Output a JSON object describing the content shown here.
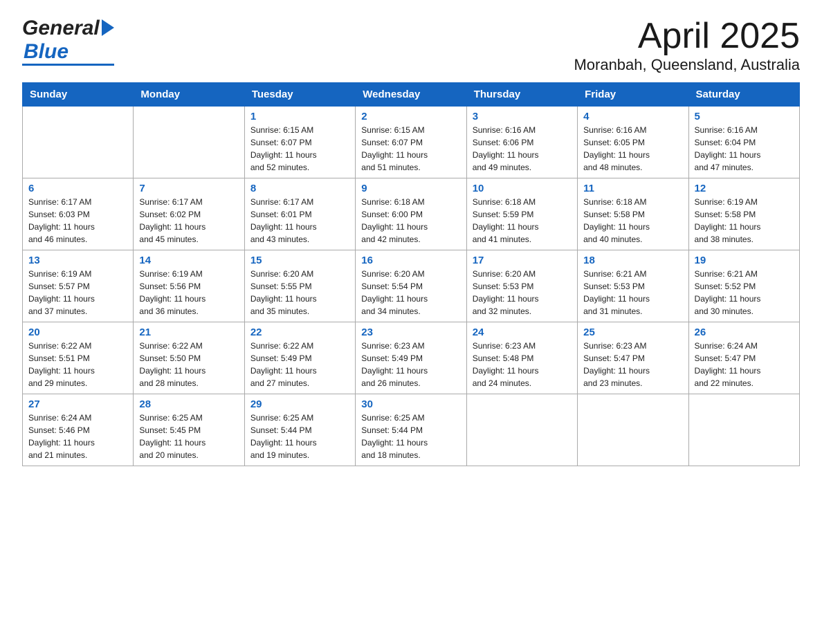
{
  "header": {
    "logo_general": "General",
    "logo_blue": "Blue",
    "month_title": "April 2025",
    "location": "Moranbah, Queensland, Australia"
  },
  "days_of_week": [
    "Sunday",
    "Monday",
    "Tuesday",
    "Wednesday",
    "Thursday",
    "Friday",
    "Saturday"
  ],
  "weeks": [
    [
      {
        "day": "",
        "info": ""
      },
      {
        "day": "",
        "info": ""
      },
      {
        "day": "1",
        "info": "Sunrise: 6:15 AM\nSunset: 6:07 PM\nDaylight: 11 hours\nand 52 minutes."
      },
      {
        "day": "2",
        "info": "Sunrise: 6:15 AM\nSunset: 6:07 PM\nDaylight: 11 hours\nand 51 minutes."
      },
      {
        "day": "3",
        "info": "Sunrise: 6:16 AM\nSunset: 6:06 PM\nDaylight: 11 hours\nand 49 minutes."
      },
      {
        "day": "4",
        "info": "Sunrise: 6:16 AM\nSunset: 6:05 PM\nDaylight: 11 hours\nand 48 minutes."
      },
      {
        "day": "5",
        "info": "Sunrise: 6:16 AM\nSunset: 6:04 PM\nDaylight: 11 hours\nand 47 minutes."
      }
    ],
    [
      {
        "day": "6",
        "info": "Sunrise: 6:17 AM\nSunset: 6:03 PM\nDaylight: 11 hours\nand 46 minutes."
      },
      {
        "day": "7",
        "info": "Sunrise: 6:17 AM\nSunset: 6:02 PM\nDaylight: 11 hours\nand 45 minutes."
      },
      {
        "day": "8",
        "info": "Sunrise: 6:17 AM\nSunset: 6:01 PM\nDaylight: 11 hours\nand 43 minutes."
      },
      {
        "day": "9",
        "info": "Sunrise: 6:18 AM\nSunset: 6:00 PM\nDaylight: 11 hours\nand 42 minutes."
      },
      {
        "day": "10",
        "info": "Sunrise: 6:18 AM\nSunset: 5:59 PM\nDaylight: 11 hours\nand 41 minutes."
      },
      {
        "day": "11",
        "info": "Sunrise: 6:18 AM\nSunset: 5:58 PM\nDaylight: 11 hours\nand 40 minutes."
      },
      {
        "day": "12",
        "info": "Sunrise: 6:19 AM\nSunset: 5:58 PM\nDaylight: 11 hours\nand 38 minutes."
      }
    ],
    [
      {
        "day": "13",
        "info": "Sunrise: 6:19 AM\nSunset: 5:57 PM\nDaylight: 11 hours\nand 37 minutes."
      },
      {
        "day": "14",
        "info": "Sunrise: 6:19 AM\nSunset: 5:56 PM\nDaylight: 11 hours\nand 36 minutes."
      },
      {
        "day": "15",
        "info": "Sunrise: 6:20 AM\nSunset: 5:55 PM\nDaylight: 11 hours\nand 35 minutes."
      },
      {
        "day": "16",
        "info": "Sunrise: 6:20 AM\nSunset: 5:54 PM\nDaylight: 11 hours\nand 34 minutes."
      },
      {
        "day": "17",
        "info": "Sunrise: 6:20 AM\nSunset: 5:53 PM\nDaylight: 11 hours\nand 32 minutes."
      },
      {
        "day": "18",
        "info": "Sunrise: 6:21 AM\nSunset: 5:53 PM\nDaylight: 11 hours\nand 31 minutes."
      },
      {
        "day": "19",
        "info": "Sunrise: 6:21 AM\nSunset: 5:52 PM\nDaylight: 11 hours\nand 30 minutes."
      }
    ],
    [
      {
        "day": "20",
        "info": "Sunrise: 6:22 AM\nSunset: 5:51 PM\nDaylight: 11 hours\nand 29 minutes."
      },
      {
        "day": "21",
        "info": "Sunrise: 6:22 AM\nSunset: 5:50 PM\nDaylight: 11 hours\nand 28 minutes."
      },
      {
        "day": "22",
        "info": "Sunrise: 6:22 AM\nSunset: 5:49 PM\nDaylight: 11 hours\nand 27 minutes."
      },
      {
        "day": "23",
        "info": "Sunrise: 6:23 AM\nSunset: 5:49 PM\nDaylight: 11 hours\nand 26 minutes."
      },
      {
        "day": "24",
        "info": "Sunrise: 6:23 AM\nSunset: 5:48 PM\nDaylight: 11 hours\nand 24 minutes."
      },
      {
        "day": "25",
        "info": "Sunrise: 6:23 AM\nSunset: 5:47 PM\nDaylight: 11 hours\nand 23 minutes."
      },
      {
        "day": "26",
        "info": "Sunrise: 6:24 AM\nSunset: 5:47 PM\nDaylight: 11 hours\nand 22 minutes."
      }
    ],
    [
      {
        "day": "27",
        "info": "Sunrise: 6:24 AM\nSunset: 5:46 PM\nDaylight: 11 hours\nand 21 minutes."
      },
      {
        "day": "28",
        "info": "Sunrise: 6:25 AM\nSunset: 5:45 PM\nDaylight: 11 hours\nand 20 minutes."
      },
      {
        "day": "29",
        "info": "Sunrise: 6:25 AM\nSunset: 5:44 PM\nDaylight: 11 hours\nand 19 minutes."
      },
      {
        "day": "30",
        "info": "Sunrise: 6:25 AM\nSunset: 5:44 PM\nDaylight: 11 hours\nand 18 minutes."
      },
      {
        "day": "",
        "info": ""
      },
      {
        "day": "",
        "info": ""
      },
      {
        "day": "",
        "info": ""
      }
    ]
  ]
}
